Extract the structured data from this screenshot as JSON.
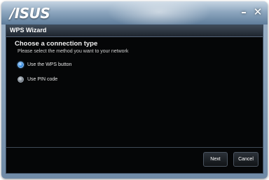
{
  "window": {
    "brand": "/ISUS",
    "minimize_glyph": "–",
    "close_glyph": "✕"
  },
  "wizard": {
    "title": "WPS Wizard",
    "heading": "Choose a connection type",
    "subtitle": "Please select the method you want to your network",
    "options": [
      {
        "label": "Use the WPS button",
        "selected": true
      },
      {
        "label": "Use PIN code",
        "selected": false
      }
    ]
  },
  "buttons": {
    "next": "Next",
    "cancel": "Cancel"
  },
  "colors": {
    "accent": "#3b8fe0",
    "content_bg": "#050607",
    "frame": "#8ea7bf"
  },
  "icons": [
    "minimize-icon",
    "close-icon",
    "radio-selected-icon",
    "radio-unselected-icon"
  ]
}
